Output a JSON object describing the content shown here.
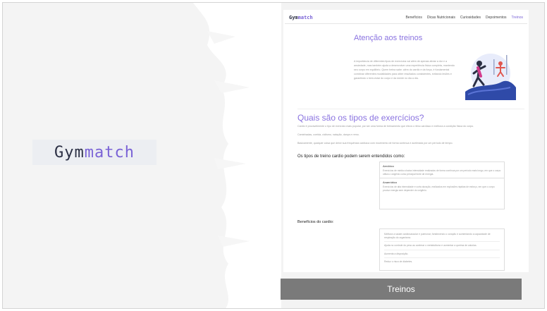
{
  "brand": {
    "gym": "Gym",
    "match": "match"
  },
  "nav": {
    "logo_gym": "Gym",
    "logo_match": "match",
    "links": [
      "Benefícios",
      "Dicas Nutricionais",
      "Curiosidades",
      "Depoimentos",
      "Treinos"
    ],
    "active_index": 4
  },
  "hero": {
    "title": "Atenção aos treinos",
    "text": "A importância de diferentes tipos de exercícios vai além de apenas aliviar a dor e a ansiedade, mas também ajuda a desenvolver uma experiência física completa, mantendo seu corpo em equilíbrio. Quem treina sabe: além do cardio e da força, é fundamental combinar diferentes modalidades para obter resultados consistentes, evitando lesões e garantindo o bem-estar do corpo e da mente no dia a dia."
  },
  "section": {
    "title": "Quais são os tipos de exercícios?",
    "p1": "Cardio é provavelmente o tipo de exercício mais popular, por ser uma forma de treinamento que eleva o ritmo cardíaco e melhora a condição física do corpo.",
    "p2": "Caminhadas, corrida, ciclismo, natação, dança e remo.",
    "p3": "Basicamente, qualquer coisa que deixe sua frequência cardíaca com movimento de forma contínua e acelerada por um período de tempo.",
    "types_heading": "Os tipos de treino cardio podem serem entendidos como:",
    "types": [
      {
        "title": "Aeróbico",
        "text": "Exercícios de média a baixa intensidade realizados de forma contínua por um período mais longo, em que o corpo utiliza o oxigênio como principal fonte de energia."
      },
      {
        "title": "Anaeróbico",
        "text": "Exercícios de alta intensidade e curta duração, realizados em explosões rápidas de esforço, em que o corpo produz energia sem depender do oxigênio."
      }
    ],
    "benefits_heading": "Benefícios do cardio:",
    "benefits": [
      "Melhora a saúde cardiovascular e pulmonar, fortalecendo o coração e aumentando a capacidade de respiração do organismo.",
      "Ajuda no controle do peso ao acelerar o metabolismo e aumentar a queima de calorias.",
      "Aumenta a disposição.",
      "Reduz o risco de diabetes."
    ]
  },
  "caption": "Treinos",
  "colors": {
    "accent": "#7a63d6",
    "dark": "#2b2f44",
    "caption_bg": "#7a7a7a"
  }
}
